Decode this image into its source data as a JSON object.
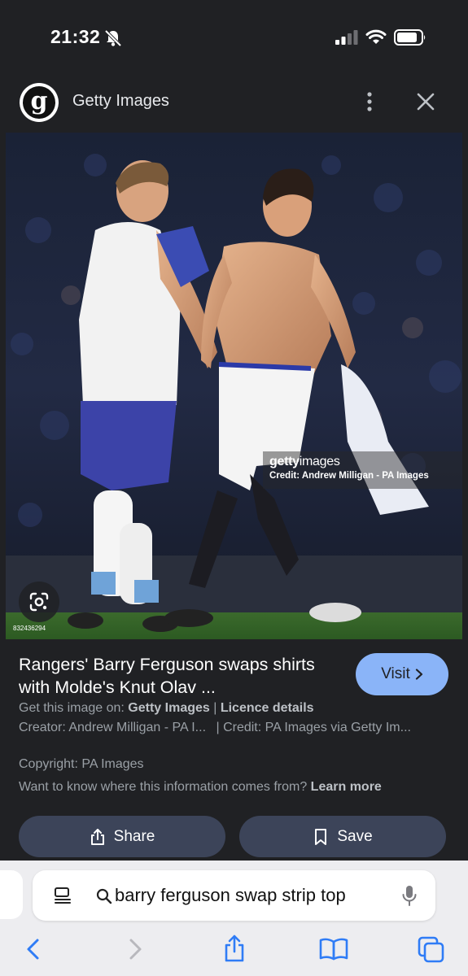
{
  "status": {
    "time": "21:32"
  },
  "source": {
    "name": "Getty Images",
    "logo_letter": "g"
  },
  "image": {
    "watermark_brand_bold": "getty",
    "watermark_brand_light": "images",
    "watermark_credit": "Credit: Andrew Milligan - PA Images",
    "image_id": "832436294"
  },
  "result": {
    "title": "Rangers' Barry Ferguson swaps shirts with Molde's Knut Olav ...",
    "visit_label": "Visit",
    "get_prefix": "Get this image on: ",
    "get_source": "Getty Images",
    "get_separator": " | ",
    "licence_label": "Licence details",
    "creator_text": "Creator: Andrew Milligan - PA I...",
    "credit_text": "| Credit: PA Images via Getty Im...",
    "copyright_text": "Copyright: PA Images",
    "info_question": "Want to know where this information comes from?",
    "learn_more": "Learn more",
    "share_label": "Share",
    "save_label": "Save"
  },
  "browser": {
    "address_text": "barry ferguson swap strip top"
  },
  "colors": {
    "background": "#202124",
    "visit_button": "#8ab4f8",
    "action_button": "#3c4459",
    "toolbar_icons": "#2f7cf6"
  },
  "icons": [
    "bell-off-icon",
    "signal-icon",
    "wifi-icon",
    "battery-icon",
    "more-vert-icon",
    "close-icon",
    "lens-icon",
    "chevron-right-icon",
    "share-icon",
    "bookmark-icon",
    "reader-icon",
    "search-icon",
    "mic-icon",
    "back-icon",
    "forward-icon",
    "safari-share-icon",
    "bookmarks-book-icon",
    "tabs-icon"
  ]
}
